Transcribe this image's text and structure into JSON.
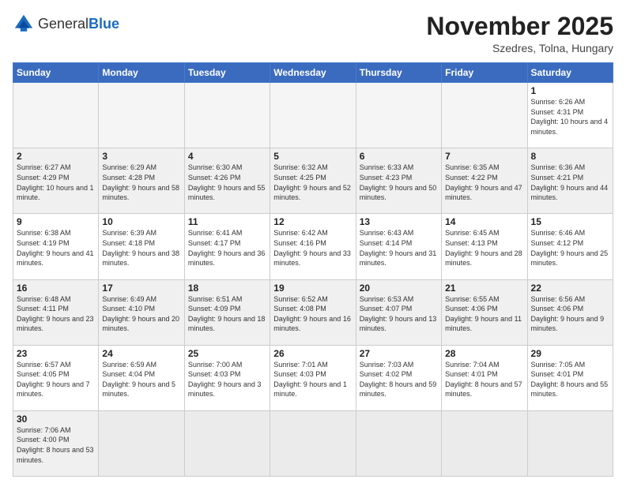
{
  "header": {
    "logo_general": "General",
    "logo_blue": "Blue",
    "month_year": "November 2025",
    "location": "Szedres, Tolna, Hungary"
  },
  "weekdays": [
    "Sunday",
    "Monday",
    "Tuesday",
    "Wednesday",
    "Thursday",
    "Friday",
    "Saturday"
  ],
  "weeks": [
    [
      {
        "day": "",
        "info": ""
      },
      {
        "day": "",
        "info": ""
      },
      {
        "day": "",
        "info": ""
      },
      {
        "day": "",
        "info": ""
      },
      {
        "day": "",
        "info": ""
      },
      {
        "day": "",
        "info": ""
      },
      {
        "day": "1",
        "info": "Sunrise: 6:26 AM\nSunset: 4:31 PM\nDaylight: 10 hours and 4 minutes."
      }
    ],
    [
      {
        "day": "2",
        "info": "Sunrise: 6:27 AM\nSunset: 4:29 PM\nDaylight: 10 hours and 1 minute."
      },
      {
        "day": "3",
        "info": "Sunrise: 6:29 AM\nSunset: 4:28 PM\nDaylight: 9 hours and 58 minutes."
      },
      {
        "day": "4",
        "info": "Sunrise: 6:30 AM\nSunset: 4:26 PM\nDaylight: 9 hours and 55 minutes."
      },
      {
        "day": "5",
        "info": "Sunrise: 6:32 AM\nSunset: 4:25 PM\nDaylight: 9 hours and 52 minutes."
      },
      {
        "day": "6",
        "info": "Sunrise: 6:33 AM\nSunset: 4:23 PM\nDaylight: 9 hours and 50 minutes."
      },
      {
        "day": "7",
        "info": "Sunrise: 6:35 AM\nSunset: 4:22 PM\nDaylight: 9 hours and 47 minutes."
      },
      {
        "day": "8",
        "info": "Sunrise: 6:36 AM\nSunset: 4:21 PM\nDaylight: 9 hours and 44 minutes."
      }
    ],
    [
      {
        "day": "9",
        "info": "Sunrise: 6:38 AM\nSunset: 4:19 PM\nDaylight: 9 hours and 41 minutes."
      },
      {
        "day": "10",
        "info": "Sunrise: 6:39 AM\nSunset: 4:18 PM\nDaylight: 9 hours and 38 minutes."
      },
      {
        "day": "11",
        "info": "Sunrise: 6:41 AM\nSunset: 4:17 PM\nDaylight: 9 hours and 36 minutes."
      },
      {
        "day": "12",
        "info": "Sunrise: 6:42 AM\nSunset: 4:16 PM\nDaylight: 9 hours and 33 minutes."
      },
      {
        "day": "13",
        "info": "Sunrise: 6:43 AM\nSunset: 4:14 PM\nDaylight: 9 hours and 31 minutes."
      },
      {
        "day": "14",
        "info": "Sunrise: 6:45 AM\nSunset: 4:13 PM\nDaylight: 9 hours and 28 minutes."
      },
      {
        "day": "15",
        "info": "Sunrise: 6:46 AM\nSunset: 4:12 PM\nDaylight: 9 hours and 25 minutes."
      }
    ],
    [
      {
        "day": "16",
        "info": "Sunrise: 6:48 AM\nSunset: 4:11 PM\nDaylight: 9 hours and 23 minutes."
      },
      {
        "day": "17",
        "info": "Sunrise: 6:49 AM\nSunset: 4:10 PM\nDaylight: 9 hours and 20 minutes."
      },
      {
        "day": "18",
        "info": "Sunrise: 6:51 AM\nSunset: 4:09 PM\nDaylight: 9 hours and 18 minutes."
      },
      {
        "day": "19",
        "info": "Sunrise: 6:52 AM\nSunset: 4:08 PM\nDaylight: 9 hours and 16 minutes."
      },
      {
        "day": "20",
        "info": "Sunrise: 6:53 AM\nSunset: 4:07 PM\nDaylight: 9 hours and 13 minutes."
      },
      {
        "day": "21",
        "info": "Sunrise: 6:55 AM\nSunset: 4:06 PM\nDaylight: 9 hours and 11 minutes."
      },
      {
        "day": "22",
        "info": "Sunrise: 6:56 AM\nSunset: 4:06 PM\nDaylight: 9 hours and 9 minutes."
      }
    ],
    [
      {
        "day": "23",
        "info": "Sunrise: 6:57 AM\nSunset: 4:05 PM\nDaylight: 9 hours and 7 minutes."
      },
      {
        "day": "24",
        "info": "Sunrise: 6:59 AM\nSunset: 4:04 PM\nDaylight: 9 hours and 5 minutes."
      },
      {
        "day": "25",
        "info": "Sunrise: 7:00 AM\nSunset: 4:03 PM\nDaylight: 9 hours and 3 minutes."
      },
      {
        "day": "26",
        "info": "Sunrise: 7:01 AM\nSunset: 4:03 PM\nDaylight: 9 hours and 1 minute."
      },
      {
        "day": "27",
        "info": "Sunrise: 7:03 AM\nSunset: 4:02 PM\nDaylight: 8 hours and 59 minutes."
      },
      {
        "day": "28",
        "info": "Sunrise: 7:04 AM\nSunset: 4:01 PM\nDaylight: 8 hours and 57 minutes."
      },
      {
        "day": "29",
        "info": "Sunrise: 7:05 AM\nSunset: 4:01 PM\nDaylight: 8 hours and 55 minutes."
      }
    ],
    [
      {
        "day": "30",
        "info": "Sunrise: 7:06 AM\nSunset: 4:00 PM\nDaylight: 8 hours and 53 minutes."
      },
      {
        "day": "",
        "info": ""
      },
      {
        "day": "",
        "info": ""
      },
      {
        "day": "",
        "info": ""
      },
      {
        "day": "",
        "info": ""
      },
      {
        "day": "",
        "info": ""
      },
      {
        "day": "",
        "info": ""
      }
    ]
  ]
}
